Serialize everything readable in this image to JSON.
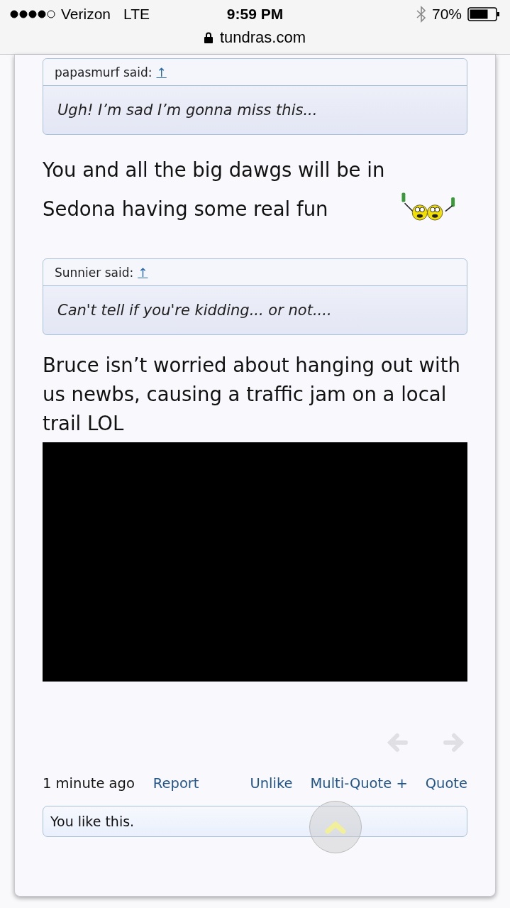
{
  "status_bar": {
    "carrier": "Verizon",
    "network": "LTE",
    "time": "9:59 PM",
    "battery": "70%"
  },
  "url_bar": {
    "domain": "tundras.com"
  },
  "post": {
    "blocks": [
      {
        "kind": "quote",
        "author": "papasmurf said:",
        "arrow": "↑",
        "text": "Ugh! I’m sad I’m gonna miss this..."
      },
      {
        "kind": "text",
        "text": "You and all the big dawgs will be in Sedona having some real fun",
        "smiley": true
      },
      {
        "kind": "quote",
        "author": "Sunnier said:",
        "arrow": "↑",
        "text": "Can't tell if you're kidding... or not...."
      },
      {
        "kind": "text",
        "text": "Bruce isn’t worried about hanging out with us newbs, causing a traffic jam on a local trail LOL",
        "smiley": false
      },
      {
        "kind": "video"
      }
    ],
    "time": "1 minute ago",
    "actions_left": [
      "Report"
    ],
    "actions_right": [
      "Unlike",
      "Multi-Quote +",
      "Quote"
    ],
    "likes": "You like this."
  }
}
